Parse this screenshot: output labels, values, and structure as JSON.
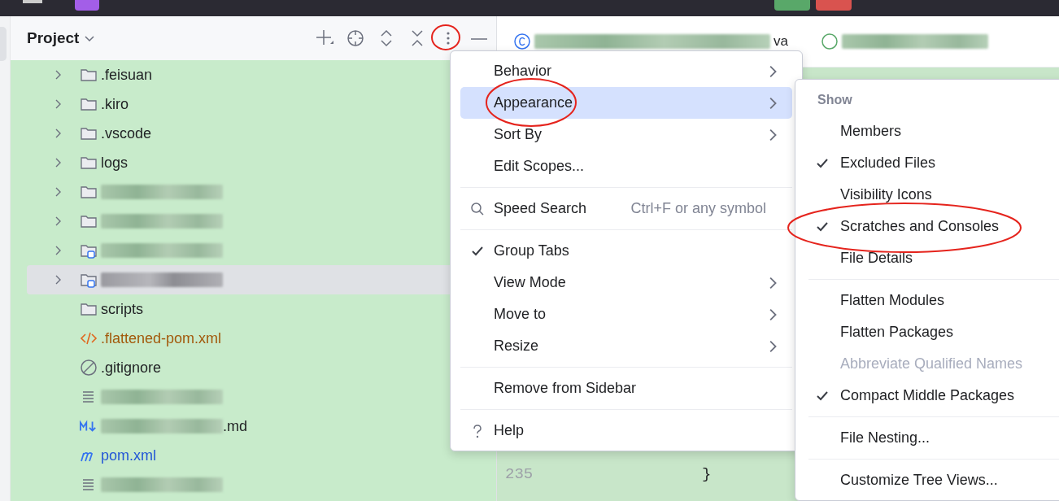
{
  "project_panel": {
    "title": "Project",
    "tree": [
      {
        "kind": "folder",
        "name": ".feisuan",
        "has_children": true,
        "selected": false
      },
      {
        "kind": "folder",
        "name": ".kiro",
        "has_children": true,
        "selected": false
      },
      {
        "kind": "folder",
        "name": ".vscode",
        "has_children": true,
        "selected": false
      },
      {
        "kind": "folder",
        "name": "logs",
        "has_children": true,
        "selected": false
      },
      {
        "kind": "folder",
        "redacted": true,
        "has_children": true,
        "selected": false
      },
      {
        "kind": "folder",
        "redacted": true,
        "has_children": true,
        "selected": false
      },
      {
        "kind": "module",
        "redacted": true,
        "has_children": true,
        "selected": false
      },
      {
        "kind": "module",
        "redacted": true,
        "has_children": true,
        "selected": true
      },
      {
        "kind": "folder",
        "name": "scripts",
        "has_children": false,
        "selected": false
      },
      {
        "kind": "xml",
        "name": ".flattened-pom.xml",
        "has_children": false,
        "selected": false
      },
      {
        "kind": "ignore",
        "name": ".gitignore",
        "has_children": false,
        "selected": false
      },
      {
        "kind": "text",
        "redacted": true,
        "has_children": false,
        "selected": false
      },
      {
        "kind": "markdown",
        "redacted": true,
        "suffix": ".md",
        "has_children": false,
        "selected": false
      },
      {
        "kind": "maven",
        "name": "pom.xml",
        "has_children": false,
        "selected": false
      },
      {
        "kind": "text",
        "redacted": true,
        "has_children": false,
        "selected": false
      }
    ]
  },
  "editor": {
    "tabs": [
      {
        "kind": "class",
        "suffix": "va"
      },
      {
        "kind": "interface"
      }
    ],
    "lines": [
      {
        "number": "235",
        "code": "}"
      }
    ]
  },
  "menu": {
    "items": [
      {
        "kind": "plain",
        "label": "Behavior",
        "has_submenu": true,
        "selected": false
      },
      {
        "kind": "plain",
        "label": "Appearance",
        "has_submenu": true,
        "selected": true
      },
      {
        "kind": "plain",
        "label": "Sort By",
        "has_submenu": true,
        "selected": false
      },
      {
        "kind": "plain",
        "label": "Edit Scopes...",
        "has_submenu": false,
        "selected": false
      },
      {
        "kind": "separator"
      },
      {
        "kind": "search",
        "label": "Speed Search",
        "shortcut": "Ctrl+F or any symbol",
        "has_submenu": false,
        "selected": false
      },
      {
        "kind": "separator"
      },
      {
        "kind": "toggle",
        "label": "Group Tabs",
        "checked": true,
        "has_submenu": false,
        "selected": false
      },
      {
        "kind": "plain",
        "label": "View Mode",
        "has_submenu": true,
        "selected": false
      },
      {
        "kind": "plain",
        "label": "Move to",
        "has_submenu": true,
        "selected": false
      },
      {
        "kind": "plain",
        "label": "Resize",
        "has_submenu": true,
        "selected": false
      },
      {
        "kind": "separator"
      },
      {
        "kind": "plain",
        "label": "Remove from Sidebar",
        "has_submenu": false,
        "selected": false
      },
      {
        "kind": "separator"
      },
      {
        "kind": "help",
        "label": "Help",
        "has_submenu": false,
        "selected": false
      }
    ]
  },
  "submenu": {
    "items": [
      {
        "kind": "header",
        "label": "Show"
      },
      {
        "kind": "toggle",
        "label": "Members",
        "checked": false,
        "disabled": false
      },
      {
        "kind": "toggle",
        "label": "Excluded Files",
        "checked": true,
        "disabled": false
      },
      {
        "kind": "toggle",
        "label": "Visibility Icons",
        "checked": false,
        "disabled": false
      },
      {
        "kind": "toggle",
        "label": "Scratches and Consoles",
        "checked": true,
        "disabled": false
      },
      {
        "kind": "toggle",
        "label": "File Details",
        "checked": false,
        "disabled": false
      },
      {
        "kind": "separator"
      },
      {
        "kind": "toggle",
        "label": "Flatten Modules",
        "checked": false,
        "disabled": false
      },
      {
        "kind": "toggle",
        "label": "Flatten Packages",
        "checked": false,
        "disabled": false
      },
      {
        "kind": "toggle",
        "label": "Abbreviate Qualified Names",
        "checked": false,
        "disabled": true
      },
      {
        "kind": "toggle",
        "label": "Compact Middle Packages",
        "checked": true,
        "disabled": false
      },
      {
        "kind": "separator"
      },
      {
        "kind": "toggle",
        "label": "File Nesting...",
        "checked": false,
        "disabled": false
      },
      {
        "kind": "separator"
      },
      {
        "kind": "toggle",
        "label": "Customize Tree Views...",
        "checked": false,
        "disabled": false
      }
    ]
  }
}
